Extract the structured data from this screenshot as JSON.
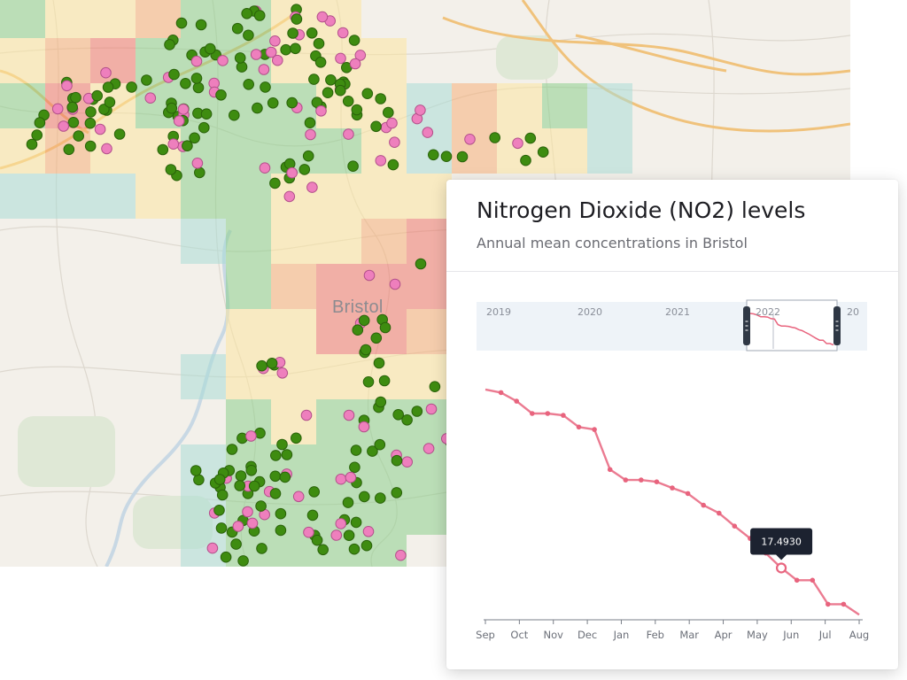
{
  "map": {
    "city_label": "Bristol",
    "colors": {
      "grid_green": "#8ccf8c",
      "grid_yellow": "#fbe6a0",
      "grid_orange": "#f6b07a",
      "grid_red": "#ef7a6e",
      "grid_teal": "#a9dcd6",
      "marker_green": "#3e8c10",
      "marker_pink": "#ee7fbd",
      "road": "#f0c27b"
    }
  },
  "chart_data": {
    "type": "line",
    "title": "Nitrogen Dioxide (NO2) levels",
    "subtitle": "Annual mean concentrations in Bristol",
    "x_tick_labels": [
      "Sep",
      "Oct",
      "Nov",
      "Dec",
      "Jan",
      "Feb",
      "Mar",
      "Apr",
      "May",
      "Jun",
      "Jul",
      "Aug"
    ],
    "navigator_tick_labels": [
      "2019",
      "2020",
      "2021",
      "2022",
      "20"
    ],
    "x": [
      0.0,
      0.55,
      0.85,
      1.7,
      1.9,
      2.25,
      2.7,
      2.95,
      3.4,
      3.75,
      4.25,
      4.5,
      4.75,
      5.1,
      5.35,
      5.6,
      5.95,
      6.3,
      7.0,
      7.9,
      8.3,
      8.6,
      9.7,
      9.87
    ],
    "values": [
      46.5,
      46.0,
      44.6,
      42.6,
      42.6,
      42.3,
      40.4,
      40.0,
      33.5,
      31.8,
      31.8,
      31.5,
      30.5,
      29.6,
      27.7,
      26.4,
      24.3,
      22.3,
      19.9,
      17.49,
      15.5,
      15.5,
      11.6,
      11.6,
      9.9
    ],
    "tooltip": {
      "label": "17.4930",
      "x": 7.9,
      "value": 17.493
    },
    "series_color": "#e8647e",
    "ylim": [
      9.5,
      47.5
    ],
    "navigator": {
      "selection_start": "2022",
      "range_labels": [
        "2019",
        "2020",
        "2021",
        "2022",
        "20"
      ]
    }
  }
}
